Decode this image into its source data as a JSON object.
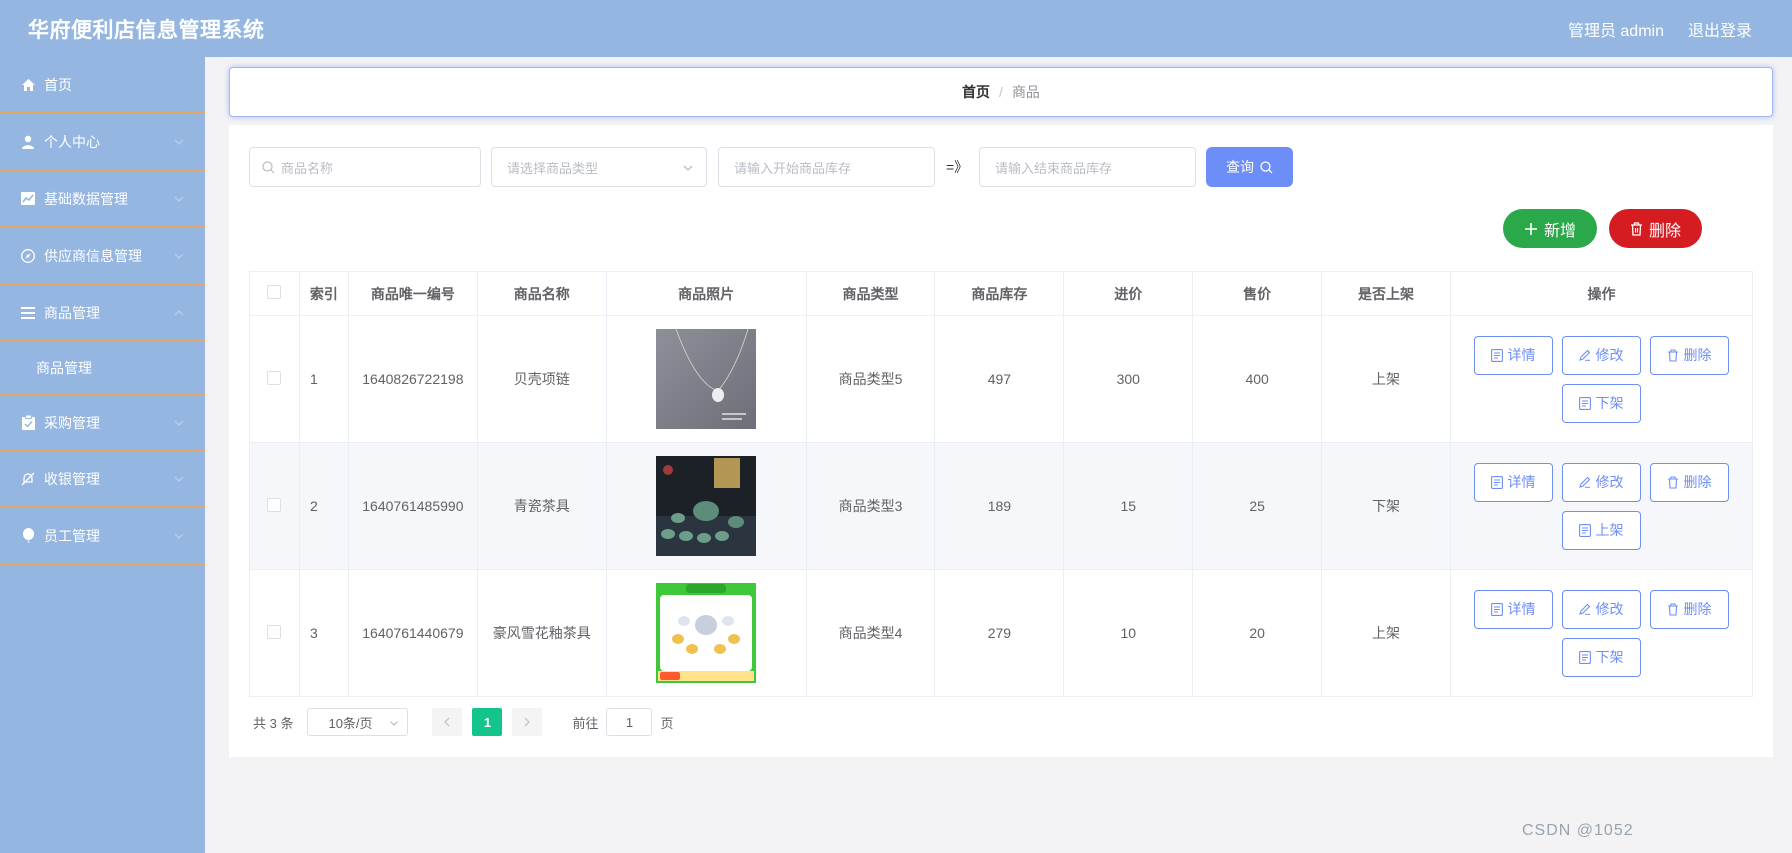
{
  "header": {
    "app_title": "华府便利店信息管理系统",
    "user_label": "管理员 admin",
    "logout_label": "退出登录"
  },
  "sidebar": {
    "items": [
      {
        "label": "首页",
        "icon": "home-icon",
        "has_children": false
      },
      {
        "label": "个人中心",
        "icon": "user-icon",
        "has_children": true
      },
      {
        "label": "基础数据管理",
        "icon": "chart-icon",
        "has_children": true
      },
      {
        "label": "供应商信息管理",
        "icon": "compass-icon",
        "has_children": true
      },
      {
        "label": "商品管理",
        "icon": "list-icon",
        "has_children": true,
        "expanded": true,
        "children": [
          {
            "label": "商品管理"
          }
        ]
      },
      {
        "label": "采购管理",
        "icon": "clipboard-icon",
        "has_children": true
      },
      {
        "label": "收银管理",
        "icon": "bell-off-icon",
        "has_children": true
      },
      {
        "label": "员工管理",
        "icon": "balloon-icon",
        "has_children": true
      }
    ]
  },
  "breadcrumb": {
    "home": "首页",
    "separator": "/",
    "current": "商品"
  },
  "filters": {
    "name_placeholder": "商品名称",
    "type_placeholder": "请选择商品类型",
    "stock_start_placeholder": "请输入开始商品库存",
    "range_separator": "=》",
    "stock_end_placeholder": "请输入结束商品库存",
    "search_label": "查询"
  },
  "actions": {
    "add_label": "新增",
    "delete_label": "删除"
  },
  "table": {
    "columns": [
      "索引",
      "商品唯一编号",
      "商品名称",
      "商品照片",
      "商品类型",
      "商品库存",
      "进价",
      "售价",
      "是否上架",
      "操作"
    ],
    "rows": [
      {
        "index": "1",
        "code": "1640826722198",
        "name": "贝壳项链",
        "photo": "necklace",
        "type": "商品类型5",
        "stock": "497",
        "cost": "300",
        "price": "400",
        "on_shelf": "上架",
        "toggle_label": "下架"
      },
      {
        "index": "2",
        "code": "1640761485990",
        "name": "青瓷茶具",
        "photo": "celadon-tea-set",
        "type": "商品类型3",
        "stock": "189",
        "cost": "15",
        "price": "25",
        "on_shelf": "下架",
        "toggle_label": "上架"
      },
      {
        "index": "3",
        "code": "1640761440679",
        "name": "豪风雪花釉茶具",
        "photo": "glaze-tea-set",
        "type": "商品类型4",
        "stock": "279",
        "cost": "10",
        "price": "20",
        "on_shelf": "上架",
        "toggle_label": "下架"
      }
    ],
    "op_detail": "详情",
    "op_edit": "修改",
    "op_delete": "删除"
  },
  "pagination": {
    "total_label": "共 3 条",
    "page_size": "10条/页",
    "current_page": "1",
    "goto_prefix": "前往",
    "goto_value": "1",
    "goto_suffix": "页"
  },
  "watermark": "CSDN @1052"
}
